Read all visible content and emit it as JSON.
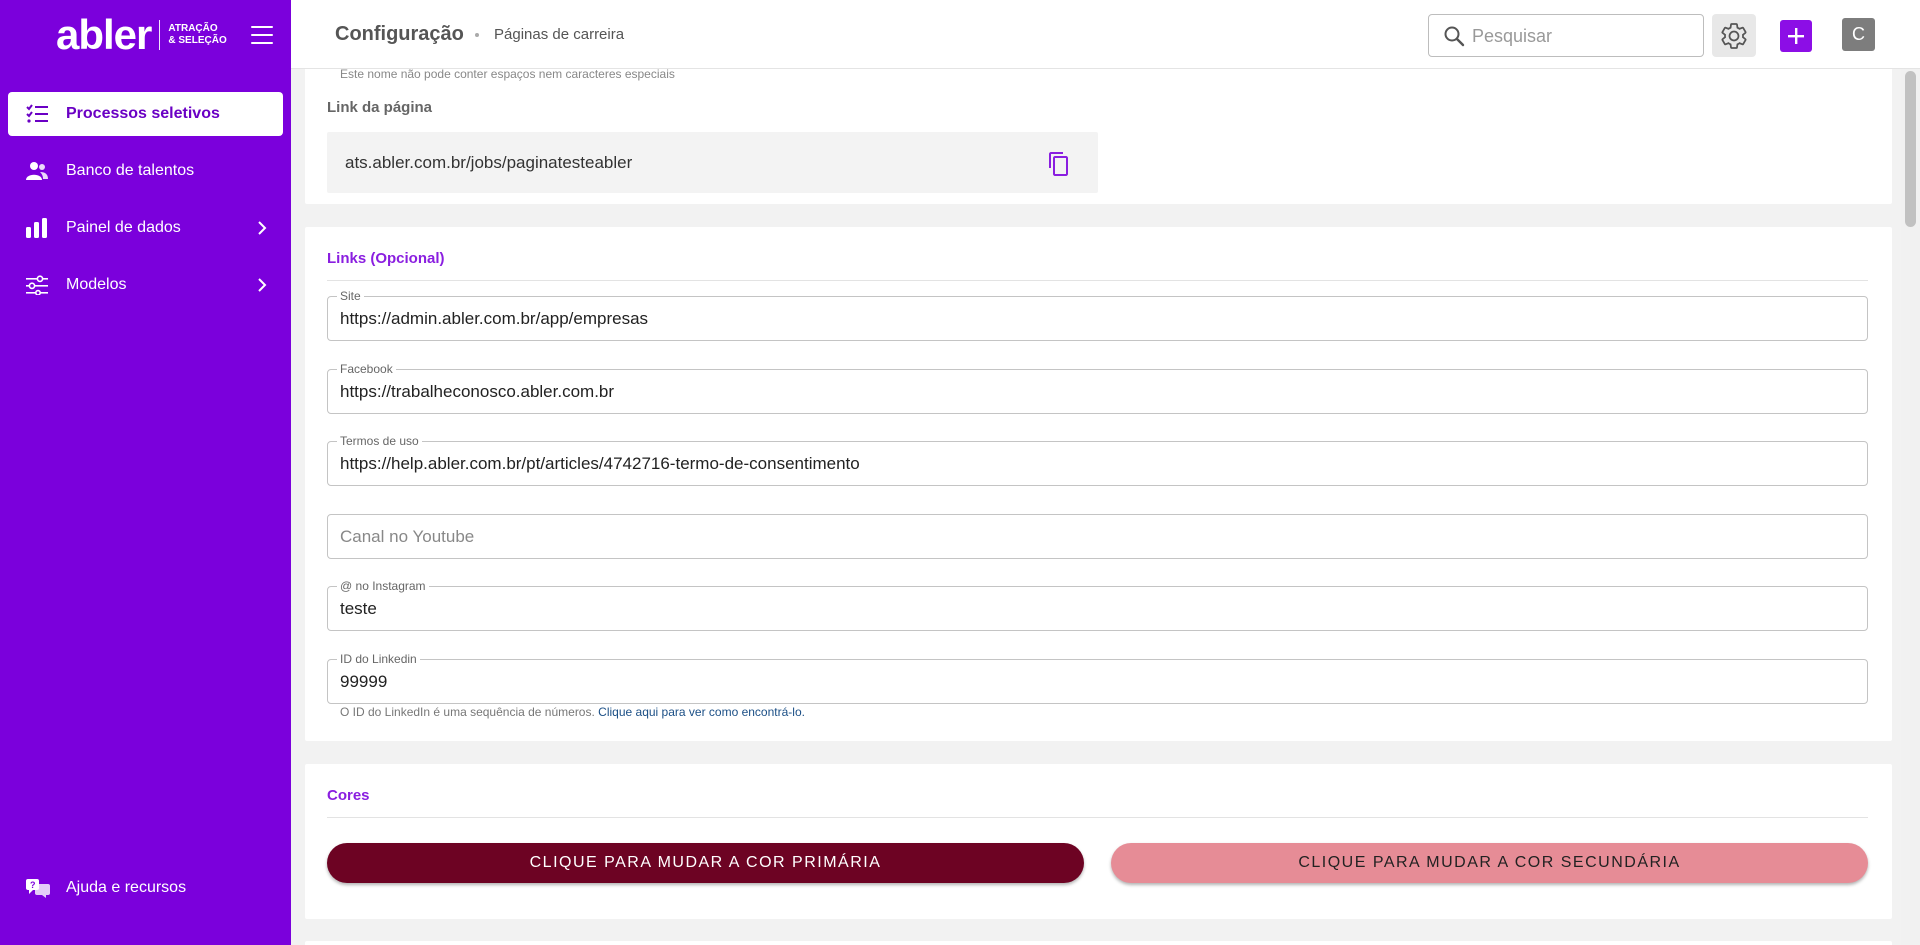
{
  "brand": {
    "name": "abler",
    "tag_line1": "ATRAÇÃO",
    "tag_line2": "& SELEÇÃO",
    "color": "#7b00dc"
  },
  "sidebar": {
    "items": [
      {
        "label": "Processos seletivos",
        "icon": "list-check-icon",
        "active": true
      },
      {
        "label": "Banco de talentos",
        "icon": "people-icon",
        "active": false
      },
      {
        "label": "Painel de dados",
        "icon": "bar-chart-icon",
        "active": false,
        "has_submenu": true
      },
      {
        "label": "Modelos",
        "icon": "sliders-icon",
        "active": false,
        "has_submenu": true
      }
    ],
    "help": {
      "label": "Ajuda e recursos",
      "icon": "help-chat-icon"
    }
  },
  "header": {
    "title": "Configuração",
    "breadcrumb": "Páginas de carreira",
    "search_placeholder": "Pesquisar",
    "avatar_initial": "C"
  },
  "page_link": {
    "cut_hint": "Este nome não pode conter espaços nem caracteres especiais",
    "label": "Link da página",
    "url": "ats.abler.com.br/jobs/paginatesteabler"
  },
  "links": {
    "title": "Links (Opcional)",
    "fields": [
      {
        "label": "Site",
        "value": "https://admin.abler.com.br/app/empresas",
        "placeholder": ""
      },
      {
        "label": "Facebook",
        "value": "https://trabalheconosco.abler.com.br",
        "placeholder": ""
      },
      {
        "label": "Termos de uso",
        "value": "https://help.abler.com.br/pt/articles/4742716-termo-de-consentimento",
        "placeholder": ""
      },
      {
        "label": "",
        "value": "",
        "placeholder": "Canal no Youtube"
      },
      {
        "label": "@ no Instagram",
        "value": "teste",
        "placeholder": ""
      },
      {
        "label": "ID do Linkedin",
        "value": "99999",
        "placeholder": ""
      }
    ],
    "helper_text": "O ID do LinkedIn é uma sequência de números.",
    "helper_link": "Clique aqui para ver como encontrá-lo."
  },
  "colors": {
    "title": "Cores",
    "primary_button": "CLIQUE PARA MUDAR A COR PRIMÁRIA",
    "secondary_button": "CLIQUE PARA MUDAR A COR SECUNDÁRIA",
    "primary_color": "#6d0323",
    "secondary_color": "#e68c96"
  }
}
